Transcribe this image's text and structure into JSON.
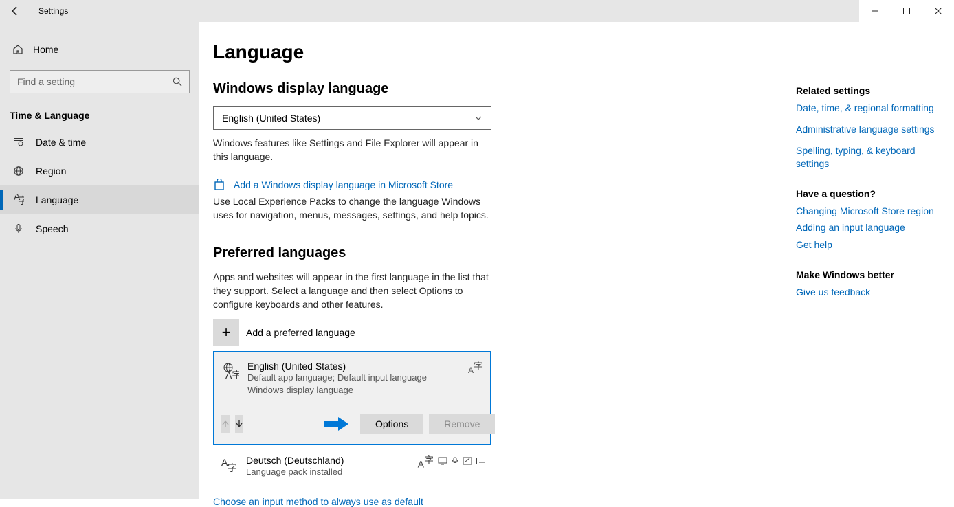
{
  "titlebar": {
    "title": "Settings"
  },
  "sidebar": {
    "home": "Home",
    "search_placeholder": "Find a setting",
    "category": "Time & Language",
    "items": [
      {
        "label": "Date & time"
      },
      {
        "label": "Region"
      },
      {
        "label": "Language"
      },
      {
        "label": "Speech"
      }
    ]
  },
  "page_title": "Language",
  "display": {
    "heading": "Windows display language",
    "value": "English (United States)",
    "desc": "Windows features like Settings and File Explorer will appear in this language.",
    "store_link": "Add a Windows display language in Microsoft Store",
    "store_desc": "Use Local Experience Packs to change the language Windows uses for navigation, menus, messages, settings, and help topics."
  },
  "preferred": {
    "heading": "Preferred languages",
    "desc": "Apps and websites will appear in the first language in the list that they support. Select a language and then select Options to configure keyboards and other features.",
    "add_label": "Add a preferred language",
    "langs": [
      {
        "name": "English (United States)",
        "sub1": "Default app language; Default input language",
        "sub2": "Windows display language",
        "options": "Options",
        "remove": "Remove"
      },
      {
        "name": "Deutsch (Deutschland)",
        "sub1": "Language pack installed"
      }
    ],
    "footer_link": "Choose an input method to always use as default"
  },
  "right": {
    "related_h": "Related settings",
    "links1": [
      "Date, time, & regional formatting",
      "Administrative language settings",
      "Spelling, typing, & keyboard settings"
    ],
    "question_h": "Have a question?",
    "links2": [
      "Changing Microsoft Store region",
      "Adding an input language",
      "Get help"
    ],
    "better_h": "Make Windows better",
    "feedback": "Give us feedback"
  }
}
